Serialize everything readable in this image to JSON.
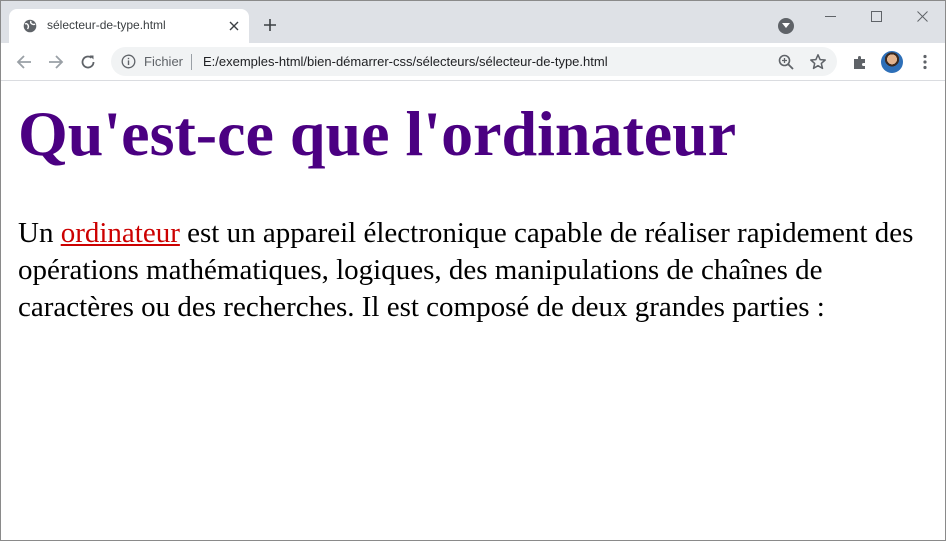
{
  "browser": {
    "tab": {
      "title": "sélecteur-de-type.html",
      "favicon": "globe-icon"
    },
    "window_controls": [
      "minimize-icon",
      "maximize-icon",
      "close-icon"
    ],
    "toolbar": {
      "back_icon": "arrow-left-icon",
      "forward_icon": "arrow-right-icon",
      "reload_icon": "reload-icon",
      "omnibox": {
        "security_icon": "info-icon",
        "scheme_label": "Fichier",
        "url": "E:/exemples-html/bien-démarrer-css/sélecteurs/sélecteur-de-type.html"
      },
      "zoom_icon": "zoom-icon",
      "bookmark_icon": "star-icon",
      "extensions_icon": "puzzle-icon",
      "menu_icon": "kebab-menu-icon"
    }
  },
  "page": {
    "heading": "Qu'est-ce que l'ordinateur",
    "paragraph": {
      "before_link": "Un ",
      "link_text": "ordinateur",
      "after_link": " est un appareil électronique capable de réaliser rapidement des opérations mathématiques, logiques, des manipulations de chaînes de caractères ou des recherches. Il est composé de deux grandes parties :"
    }
  },
  "colors": {
    "heading": "#4b0082",
    "link": "#cc0000",
    "tabstrip": "#dee1e6",
    "omnibox": "#f1f3f4"
  }
}
